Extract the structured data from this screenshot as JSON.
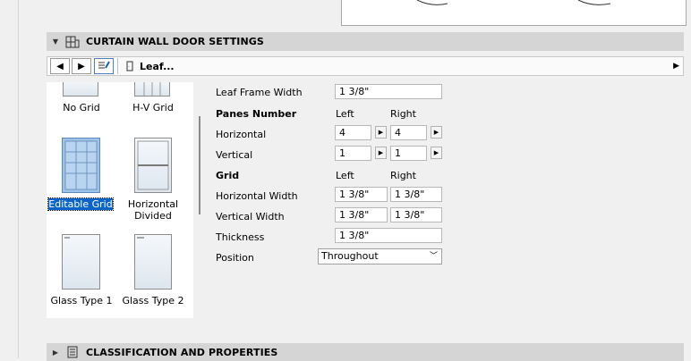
{
  "section_door": {
    "title": "CURTAIN WALL DOOR SETTINGS"
  },
  "toolbar": {
    "leaf_label": "Leaf..."
  },
  "thumbnails": [
    {
      "label": "No Grid"
    },
    {
      "label": "H-V Grid"
    },
    {
      "label": "Editable Grid"
    },
    {
      "label": "Horizontal Divided"
    },
    {
      "label": "Glass Type 1"
    },
    {
      "label": "Glass Type 2"
    }
  ],
  "props": {
    "leaf_frame_width": {
      "label": "Leaf Frame Width",
      "value": "1 3/8\""
    },
    "panes_number": {
      "label": "Panes Number",
      "left": "Left",
      "right": "Right"
    },
    "horizontal": {
      "label": "Horizontal",
      "left": "4",
      "right": "4"
    },
    "vertical": {
      "label": "Vertical",
      "left": "1",
      "right": "1"
    },
    "grid": {
      "label": "Grid",
      "left": "Left",
      "right": "Right"
    },
    "horizontal_width": {
      "label": "Horizontal Width",
      "left": "1 3/8\"",
      "right": "1 3/8\""
    },
    "vertical_width": {
      "label": "Vertical Width",
      "left": "1 3/8\"",
      "right": "1 3/8\""
    },
    "thickness": {
      "label": "Thickness",
      "value": "1 3/8\""
    },
    "position": {
      "label": "Position",
      "value": "Throughout"
    }
  },
  "section_class": {
    "title": "CLASSIFICATION AND PROPERTIES"
  },
  "colors": {
    "selection": "#0a64c8",
    "header_bg": "#d5d5d5"
  }
}
